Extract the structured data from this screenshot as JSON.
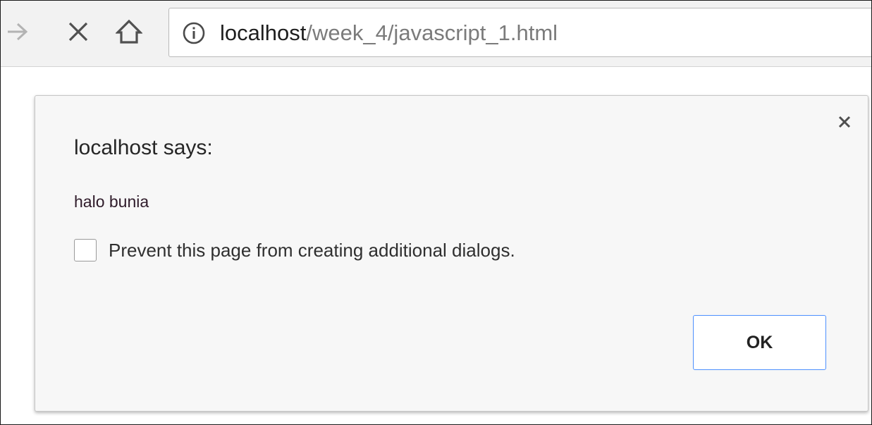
{
  "browser": {
    "url_host": "localhost",
    "url_path": "/week_4/javascript_1.html",
    "icons": {
      "forward": "forward-arrow-icon",
      "stop": "close-x-icon",
      "home": "home-icon",
      "site_info": "info-circle-icon"
    }
  },
  "dialog": {
    "title": "localhost says:",
    "message": "halo bunia",
    "suppress_label": "Prevent this page from creating additional dialogs.",
    "suppress_checked": false,
    "ok_label": "OK",
    "close_icon": "close-icon",
    "colors": {
      "ok_border": "#4d90fe",
      "background": "#f7f7f7"
    }
  }
}
